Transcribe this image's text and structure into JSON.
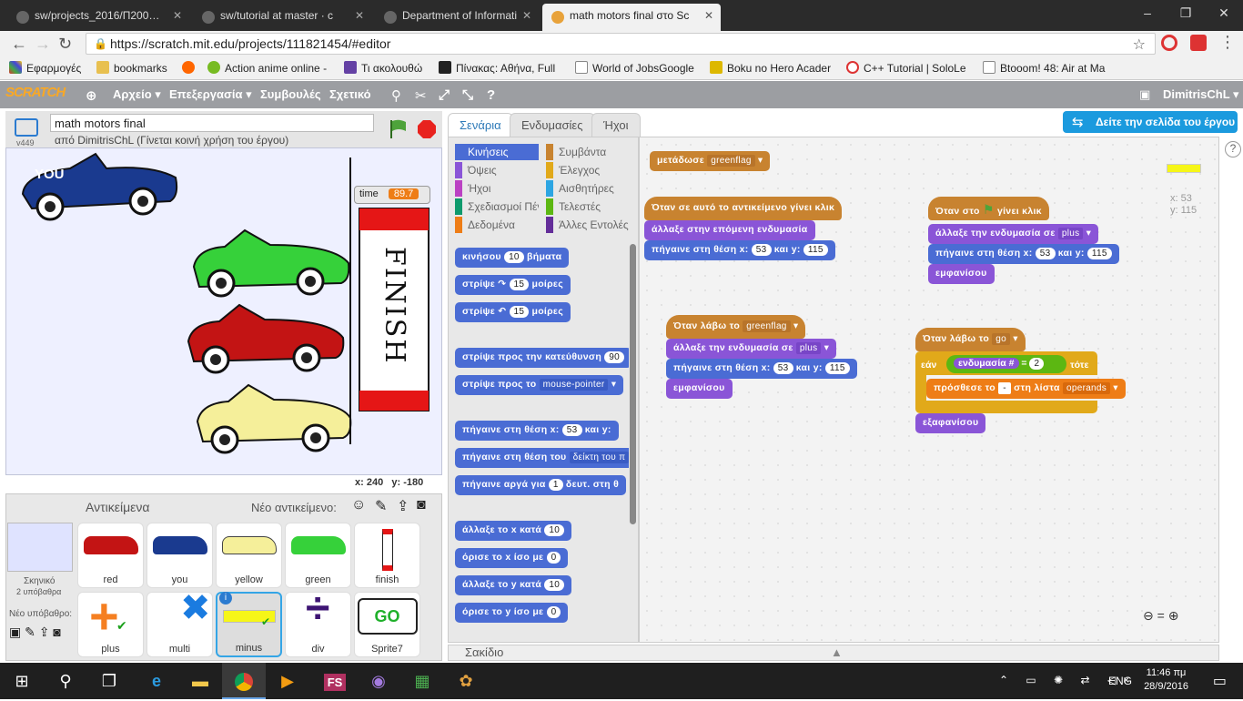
{
  "browser": {
    "tabs": [
      "sw/projects_2016/Π200…",
      "sw/tutorial at master · c",
      "Department of Informati",
      "math motors final στο Sc"
    ],
    "url": "https://scratch.mit.edu/projects/111821454/#editor",
    "bookmarks": [
      "Εφαρμογές",
      "bookmarks",
      "Action anime online -",
      "Τι ακολουθώ",
      "Πίνακας: Αθήνα, Full",
      "World of JobsGoogle",
      "Boku no Hero Acader",
      "C++ Tutorial | SoloLe",
      "Btooom! 48: Air at Ma"
    ]
  },
  "scratch": {
    "logo": "SCRATCH",
    "menu": [
      "Αρχείο ▾",
      "Επεξεργασία ▾",
      "Συμβουλές",
      "Σχετικό"
    ],
    "user": "DimitrisChL ▾",
    "project_title": "math motors final",
    "version": "v449",
    "author": "από DimitrisChL (Γίνεται κοινή χρήση του έργου)",
    "see_project": "Δείτε την σελίδα του έργου",
    "tabs": [
      "Σενάρια",
      "Ενδυμασίες",
      "Ήχοι"
    ]
  },
  "stage": {
    "you_label": "YOU",
    "time_label": "time",
    "time_value": "89.7",
    "finish_label": "FINISH",
    "x": "x: 240",
    "y": "y: -180"
  },
  "sprites": {
    "header": "Αντικείμενα",
    "new_sprite": "Νέο αντικείμενο:",
    "stage_label": "Σκηνικό",
    "stage_sub": "2 υπόβαθρα",
    "new_backdrop": "Νέο υπόβαθρο:",
    "items": [
      "red",
      "you",
      "yellow",
      "green",
      "finish",
      "plus",
      "multi",
      "minus",
      "div",
      "Sprite7"
    ],
    "go_label": "GO"
  },
  "categories": {
    "left": [
      "Κινήσεις",
      "Όψεις",
      "Ήχοι",
      "Σχεδιασμοί Πένα",
      "Δεδομένα"
    ],
    "right": [
      "Συμβάντα",
      "Έλεγχος",
      "Αισθητήρες",
      "Τελεστές",
      "Άλλες Εντολές"
    ],
    "colors_left": [
      "#4a6cd4",
      "#8a55d7",
      "#bb42c3",
      "#0e9a6c",
      "#ee7d16"
    ],
    "colors_right": [
      "#c88330",
      "#e1a91a",
      "#2ca5e2",
      "#5cb712",
      "#632d99"
    ]
  },
  "palette": {
    "b1": "κινήσου",
    "b1n": "10",
    "b1s": "βήματα",
    "b2": "στρίψε ↷",
    "b2n": "15",
    "b2s": "μοίρες",
    "b3": "στρίψε ↶",
    "b3n": "15",
    "b3s": "μοίρες",
    "b4": "στρίψε προς την κατεύθυνση",
    "b4n": "90",
    "b5": "στρίψε προς το",
    "b5d": "mouse-pointer",
    "b6": "πήγαινε στη θέση x:",
    "b6n": "53",
    "b6s": "και y:",
    "b7": "πήγαινε στη θέση του",
    "b7d": "δείκτη του π",
    "b8": "πήγαινε αργά για",
    "b8n": "1",
    "b8s": "δευτ. στη θ",
    "b9": "άλλαξε το x κατά",
    "b9n": "10",
    "b10": "όρισε το x ίσο με",
    "b10n": "0",
    "b11": "άλλαξε το y κατά",
    "b11n": "10",
    "b12": "όρισε το y ίσο με",
    "b12n": "0"
  },
  "scripts": {
    "s0": "μετάδωσε",
    "s0d": "greenflag",
    "s1h": "Όταν σε αυτό το αντικείμενο γίνει κλικ",
    "s1a": "άλλαξε στην επόμενη ενδυμασία",
    "s1b": "πήγαινε στη θέση x:",
    "s1bn": "53",
    "s1bs": "και y:",
    "s1bn2": "115",
    "s2h": "Όταν στο",
    "s2h2": "γίνει κλικ",
    "s2a": "άλλαξε την ενδυμασία σε",
    "s2ad": "plus",
    "s2b": "πήγαινε στη θέση x:",
    "s2bn": "53",
    "s2bs": "και y:",
    "s2bn2": "115",
    "s2c": "εμφανίσου",
    "s3h": "Όταν λάβω το",
    "s3hd": "greenflag",
    "s3a": "άλλαξε την ενδυμασία σε",
    "s3ad": "plus",
    "s3b": "πήγαινε στη θέση x:",
    "s3bn": "53",
    "s3bs": "και y:",
    "s3bn2": "115",
    "s3c": "εμφανίσου",
    "s4h": "Όταν λάβω το",
    "s4hd": "go",
    "s4if": "εάν",
    "s4cond": "ενδυμασία #",
    "s4eq": "=",
    "s4n": "2",
    "s4then": "τότε",
    "s4add": "πρόσθεσε το",
    "s4addv": "-",
    "s4list": "στη λίστα",
    "s4listd": "operands",
    "s4hide": "εξαφανίσου",
    "xy_x": "x: 53",
    "xy_y": "y: 115"
  },
  "backpack": "Σακίδιο",
  "taskbar": {
    "lang": "ENG",
    "time": "11:46 πμ",
    "date": "28/9/2016",
    "fs": "FS"
  }
}
